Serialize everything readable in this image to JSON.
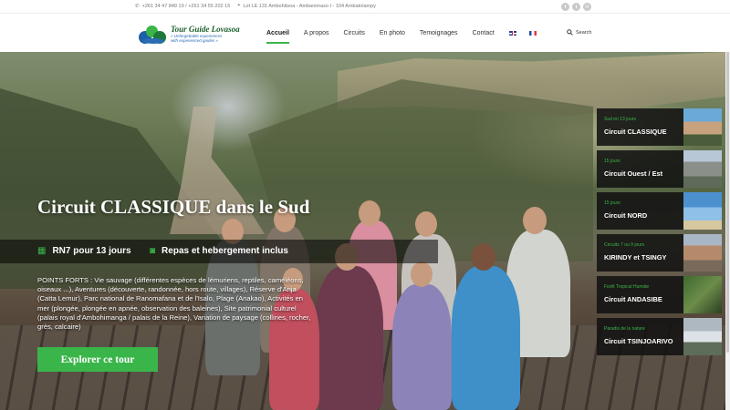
{
  "topbar": {
    "phone": "+261 34 47 849 19 / +261 34 55 202 15",
    "address": "Lot LE 131 Ambohitsoa - Ambanimaso I - 104 Ambatolampy",
    "social": [
      {
        "icon": "facebook-icon",
        "glyph": "f"
      },
      {
        "icon": "twitter-icon",
        "glyph": "t"
      },
      {
        "icon": "email-icon",
        "glyph": "✉"
      }
    ]
  },
  "logo": {
    "brand": "Tour Guide Lovasoa",
    "tagline_1": "« Unforgettable experiences",
    "tagline_2": "with experienced guides »"
  },
  "nav": {
    "items": [
      "Accueil",
      "A propos",
      "Circuits",
      "En photo",
      "Temoignages",
      "Contact"
    ],
    "search_label": "Search"
  },
  "hero": {
    "title": "Circuit CLASSIQUE dans le Sud",
    "feature_1": "RN7 pour 13 jours",
    "feature_2": "Repas et hebergement inclus",
    "description": "POINTS FORTS : Vie sauvage (différentes espèces de lémuriens, reptiles, caméléons, oiseaux ...), Aventures (découverte, randonnée, hors route, villages), Réserve d'Anja (Catta Lemur), Parc national de Ranomafana et de l'Isalo, Plage (Anakao), Activités en mer (plongée, plongée en apnée, observation des baleines), Site patrimonial culturel (palais royal d'Ambohimanga / palais de la Reine), Variation de paysage (collines, rocher, grès, calcaire)",
    "cta": "Explorer ce tour"
  },
  "cards": [
    {
      "sub": "Sud en 13 jours",
      "name": "Circuit CLASSIQUE",
      "thumb": [
        "#6aa9d8",
        "#c8a27f",
        "#4a5c3a"
      ]
    },
    {
      "sub": "15 jours",
      "name": "Circuit Ouest / Est",
      "thumb": [
        "#b7c7d6",
        "#8b8f8a",
        "#5f6a5a"
      ]
    },
    {
      "sub": "15 jours",
      "name": "Circuit NORD",
      "thumb": [
        "#4d90d0",
        "#8fc0e8",
        "#d7c7a0"
      ]
    },
    {
      "sub": "Circuits 7 ou 9 jours",
      "name": "KIRINDY et TSINGY",
      "thumb": [
        "#a9b6c6",
        "#b58a6b",
        "#7a6a5c"
      ]
    },
    {
      "sub": "Forêt Tropical Humide",
      "name": "Circuit ANDASIBE",
      "thumb": [
        "#3e6a2e",
        "#6c8c4a",
        "#2c3f22"
      ]
    },
    {
      "sub": "Paradis de la nature",
      "name": "Circuit TSINJOARIVO",
      "thumb": [
        "#aeb8c0",
        "#dde2e6",
        "#5d6d5a"
      ]
    }
  ],
  "colors": {
    "accent": "#3ab54a",
    "card_bg": "#121212"
  }
}
